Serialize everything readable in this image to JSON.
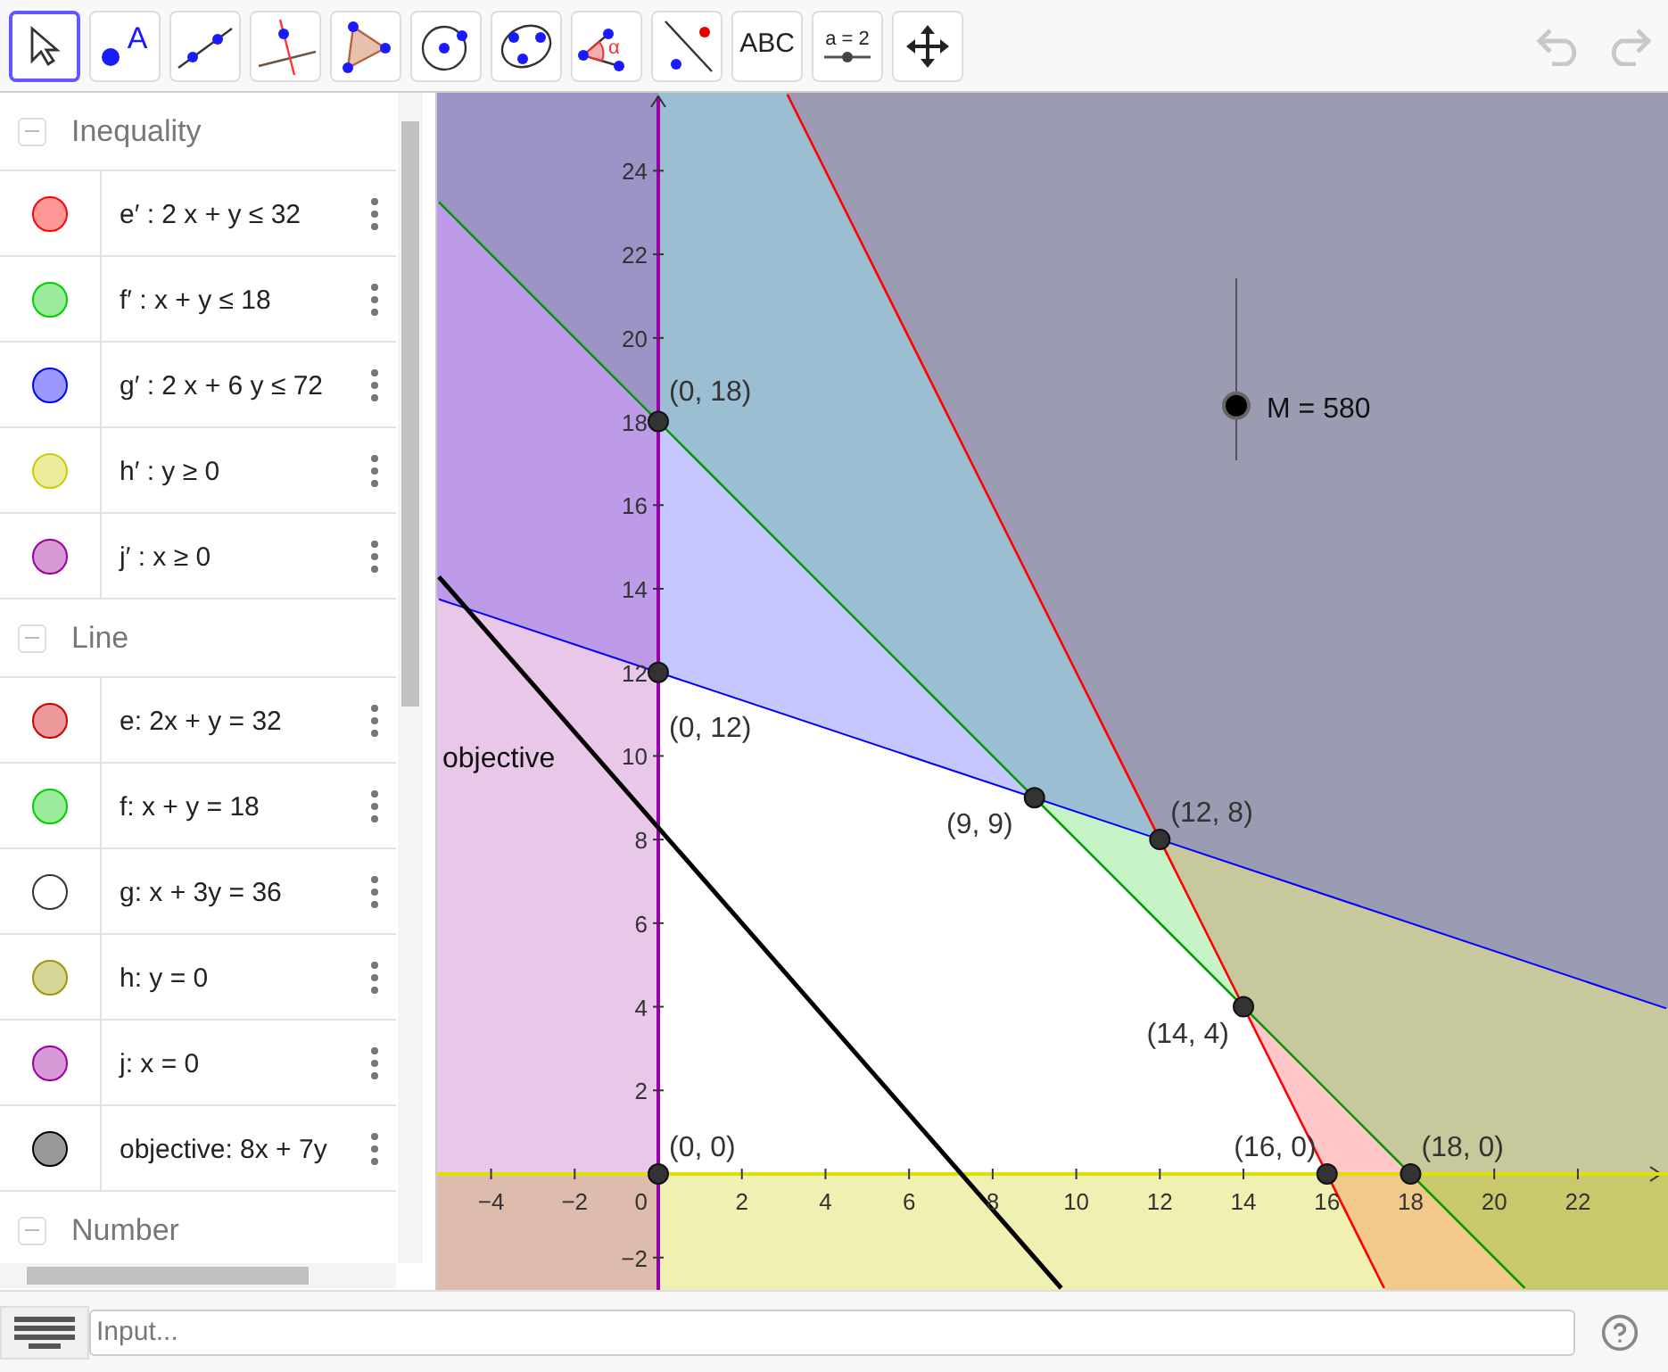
{
  "toolbar": {
    "tools": [
      {
        "kind": "move",
        "selected": true
      },
      {
        "kind": "point",
        "label": "A",
        "selected": false
      },
      {
        "kind": "line",
        "selected": false
      },
      {
        "kind": "perpendicular",
        "selected": false
      },
      {
        "kind": "polygon",
        "selected": false
      },
      {
        "kind": "circle",
        "selected": false
      },
      {
        "kind": "conic",
        "selected": false
      },
      {
        "kind": "angle",
        "label": "α",
        "selected": false
      },
      {
        "kind": "reflect",
        "selected": false
      },
      {
        "kind": "text",
        "label": "ABC",
        "selected": false
      },
      {
        "kind": "slider",
        "label": "a = 2",
        "selected": false
      },
      {
        "kind": "pan",
        "selected": false
      }
    ],
    "undo": {
      "disabled": true
    },
    "redo": {
      "disabled": true
    }
  },
  "algebra": {
    "groups": [
      {
        "title": "Inequality",
        "expanded": true,
        "items": [
          {
            "text": "e′ : 2 x + y ≤ 32",
            "color": "#ff0000",
            "visible": true
          },
          {
            "text": "f′ : x + y ≤ 18",
            "color": "#00cc00",
            "visible": true
          },
          {
            "text": "g′ : 2 x + 6 y ≤ 72",
            "color": "#0000ff",
            "visible": true
          },
          {
            "text": "h′ : y ≥ 0",
            "color": "#cccc00",
            "visible": true
          },
          {
            "text": "j′ : x ≥ 0",
            "color": "#990099",
            "visible": true
          }
        ]
      },
      {
        "title": "Line",
        "expanded": true,
        "items": [
          {
            "text": "e: 2x + y = 32",
            "color": "#cc0000",
            "visible": true
          },
          {
            "text": "f: x + y = 18",
            "color": "#00cc00",
            "visible": true
          },
          {
            "text": "g: x + 3y = 36",
            "color": "#333333",
            "visible": false
          },
          {
            "text": "h: y = 0",
            "color": "#999900",
            "visible": true
          },
          {
            "text": "j: x = 0",
            "color": "#990099",
            "visible": true
          },
          {
            "text": "objective: 8x + 7y",
            "color": "#000000",
            "visible": true
          }
        ]
      },
      {
        "title": "Number",
        "expanded": true
      }
    ]
  },
  "graphics": {
    "x_ticks": [
      "−4",
      "−2",
      "2",
      "4",
      "6",
      "8",
      "10",
      "12",
      "14",
      "16",
      "18",
      "20",
      "22"
    ],
    "y_ticks": [
      "24",
      "22",
      "20",
      "18",
      "16",
      "14",
      "12",
      "10",
      "8",
      "6",
      "4",
      "2",
      "−2"
    ],
    "origin_label": "0",
    "points": [
      "(0, 18)",
      "(0, 12)",
      "(9, 9)",
      "(12, 8)",
      "(14, 4)",
      "(0, 0)",
      "(16, 0)",
      "(18, 0)"
    ],
    "objective_label": "objective",
    "slider": {
      "label": "M = 580",
      "level": 0.3
    }
  },
  "input_bar": {
    "placeholder": "Input..."
  }
}
